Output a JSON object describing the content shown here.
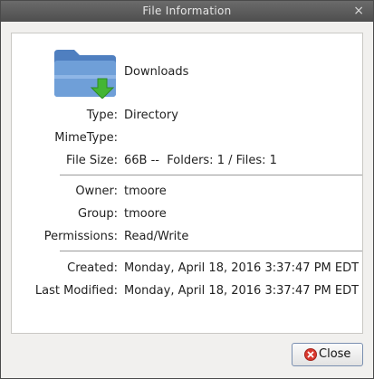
{
  "window": {
    "title": "File Information",
    "close_glyph": "×"
  },
  "file": {
    "name": "Downloads",
    "icon": "folder-download-icon"
  },
  "details": [
    {
      "label": "Type:",
      "value": "Directory"
    },
    {
      "label": "MimeType:",
      "value": ""
    },
    {
      "label": "File Size:",
      "value": "66B --  Folders: 1 / Files: 1"
    },
    {
      "label": "Owner:",
      "value": "tmoore"
    },
    {
      "label": "Group:",
      "value": "tmoore"
    },
    {
      "label": "Permissions:",
      "value": "Read/Write"
    },
    {
      "label": "Created:",
      "value": "Monday, April 18, 2016 3:37:47 PM EDT"
    },
    {
      "label": "Last Modified:",
      "value": "Monday, April 18, 2016 3:37:47 PM EDT"
    }
  ],
  "buttons": {
    "close_label": "Close",
    "close_icon": "close-circle-icon"
  },
  "colors": {
    "folder": "#6f9fd8",
    "download_arrow": "#44b534",
    "close_icon": "#d9382e"
  }
}
